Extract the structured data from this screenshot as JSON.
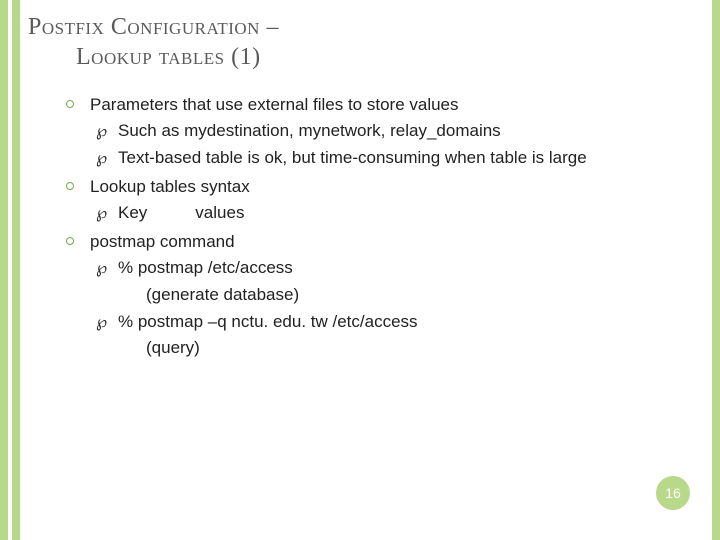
{
  "title": {
    "line1_a": "P",
    "line1_b": "ostfix ",
    "line1_c": "C",
    "line1_d": "onfiguration –",
    "line2_a": "L",
    "line2_b": "ookup tables (1)"
  },
  "bullets": [
    {
      "text": "Parameters that use external files to store values",
      "sub": [
        {
          "text": "Such as mydestination, mynetwork, relay_domains"
        },
        {
          "text": "Text-based table is ok, but time-consuming when table is large"
        }
      ]
    },
    {
      "text": "Lookup tables syntax",
      "sub": [
        {
          "key": "Key",
          "values": "values"
        }
      ]
    },
    {
      "text": "postmap command",
      "sub": [
        {
          "text": "% postmap /etc/access",
          "note": "(generate database)"
        },
        {
          "text": "% postmap –q nctu. edu. tw /etc/access",
          "note": "(query)"
        }
      ]
    }
  ],
  "page_number": "16",
  "glyphs": {
    "sub_bullet": "༎"
  }
}
